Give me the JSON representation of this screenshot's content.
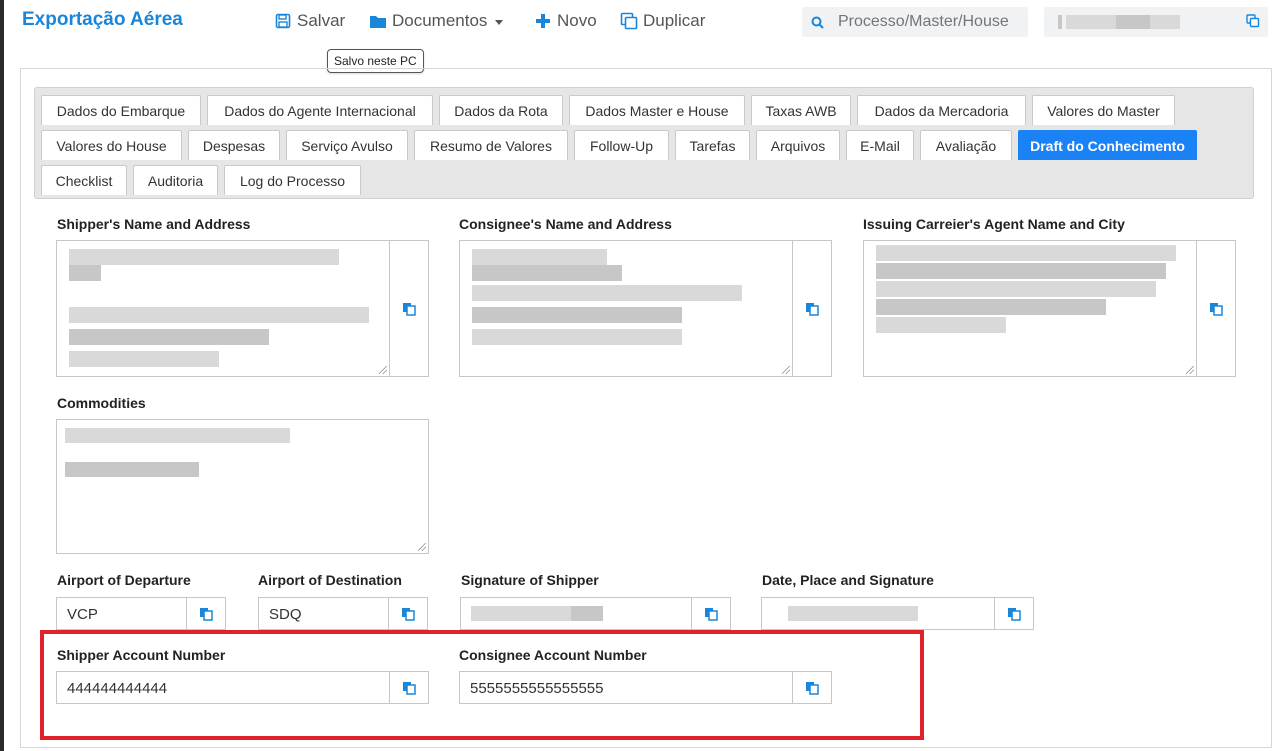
{
  "header": {
    "app_title": "Exportação Aérea",
    "buttons": {
      "save": "Salvar",
      "documents": "Documentos",
      "new": "Novo",
      "duplicate": "Duplicar"
    },
    "search_placeholder": "Processo/Master/House",
    "tooltip": "Salvo neste PC"
  },
  "tabs": [
    "Dados do Embarque",
    "Dados do Agente Internacional",
    "Dados da Rota",
    "Dados Master e House",
    "Taxas AWB",
    "Dados da Mercadoria",
    "Valores do Master",
    "Valores do House",
    "Despesas",
    "Serviço Avulso",
    "Resumo de Valores",
    "Follow-Up",
    "Tarefas",
    "Arquivos",
    "E-Mail",
    "Avaliação",
    "Draft do Conhecimento",
    "Checklist",
    "Auditoria",
    "Log do Processo"
  ],
  "active_tab": "Draft do Conhecimento",
  "form": {
    "shipper_label": "Shipper's Name and Address",
    "consignee_label": "Consignee's Name and Address",
    "issuing_label": "Issuing Carreier's Agent Name and City",
    "commodities_label": "Commodities",
    "departure_label": "Airport of Departure",
    "departure_value": "VCP",
    "destination_label": "Airport of Destination",
    "destination_value": "SDQ",
    "signature_shipper_label": "Signature of Shipper",
    "date_place_label": "Date, Place and Signature",
    "shipper_account_label": "Shipper Account Number",
    "shipper_account_value": "444444444444",
    "consignee_account_label": "Consignee Account Number",
    "consignee_account_value": "5555555555555555"
  },
  "colors": {
    "brand": "#1a86d9",
    "active_tab": "#1a82f5",
    "highlight": "#e0222b"
  }
}
